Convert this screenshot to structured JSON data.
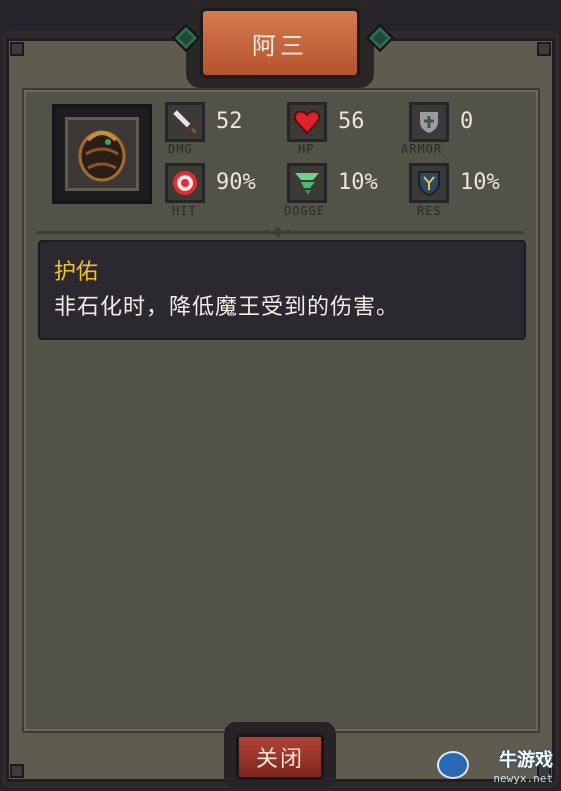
{
  "title": "阿三",
  "unit": {
    "portrait": "armored-worm-portrait",
    "stats": [
      {
        "key": "dmg",
        "icon": "sword-icon",
        "value": "52",
        "label": "DMG"
      },
      {
        "key": "hp",
        "icon": "heart-icon",
        "value": "56",
        "label": "HP"
      },
      {
        "key": "armor",
        "icon": "shield-icon",
        "value": "0",
        "label": "ARMOR"
      },
      {
        "key": "hit",
        "icon": "target-icon",
        "value": "90%",
        "label": "HIT"
      },
      {
        "key": "dodge",
        "icon": "tornado-icon",
        "value": "10%",
        "label": "DOGGE"
      },
      {
        "key": "res",
        "icon": "magic-shield-icon",
        "value": "10%",
        "label": "RES"
      }
    ]
  },
  "skill": {
    "name": "护佑",
    "description": "非石化时，降低魔王受到的伤害。"
  },
  "close_button": {
    "label": "关闭"
  },
  "watermark": {
    "main": "牛游戏",
    "sub": "newyx.net"
  },
  "colors": {
    "skill_name": "#f3c12a",
    "title_plaque": "#c8643b",
    "close_button": "#a0362c"
  }
}
